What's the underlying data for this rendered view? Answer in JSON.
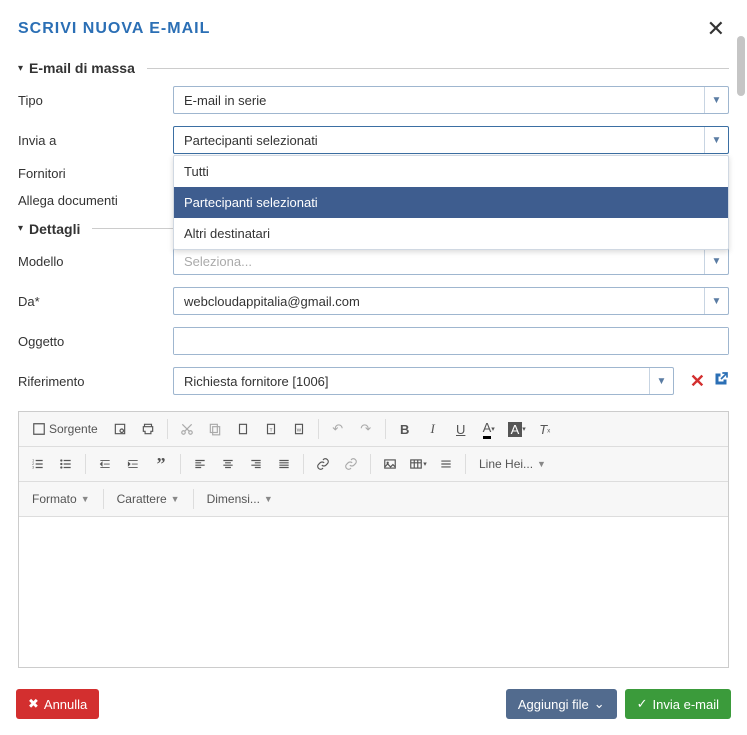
{
  "header": {
    "title": "SCRIVI NUOVA E-MAIL"
  },
  "section1": {
    "title": "E-mail di massa"
  },
  "section2": {
    "title": "Dettagli"
  },
  "fields": {
    "tipo": {
      "label": "Tipo",
      "value": "E-mail in serie"
    },
    "invia": {
      "label": "Invia a",
      "value": "Partecipanti selezionati"
    },
    "fornitori": {
      "label": "Fornitori"
    },
    "allega": {
      "label": "Allega documenti"
    },
    "modello": {
      "label": "Modello",
      "placeholder": "Seleziona..."
    },
    "da": {
      "label": "Da*",
      "value": "webcloudappitalia@gmail.com"
    },
    "oggetto": {
      "label": "Oggetto",
      "value": ""
    },
    "riferimento": {
      "label": "Riferimento",
      "value": "Richiesta fornitore [1006]"
    }
  },
  "dropdown": {
    "opt0": "Tutti",
    "opt1": "Partecipanti selezionati",
    "opt2": "Altri destinatari"
  },
  "editor": {
    "sorgente": "Sorgente",
    "lineheight": "Line Hei...",
    "formato": "Formato",
    "carattere": "Carattere",
    "dimensi": "Dimensi..."
  },
  "footer": {
    "cancel": "Annulla",
    "attach": "Aggiungi file",
    "send": "Invia e-mail"
  }
}
